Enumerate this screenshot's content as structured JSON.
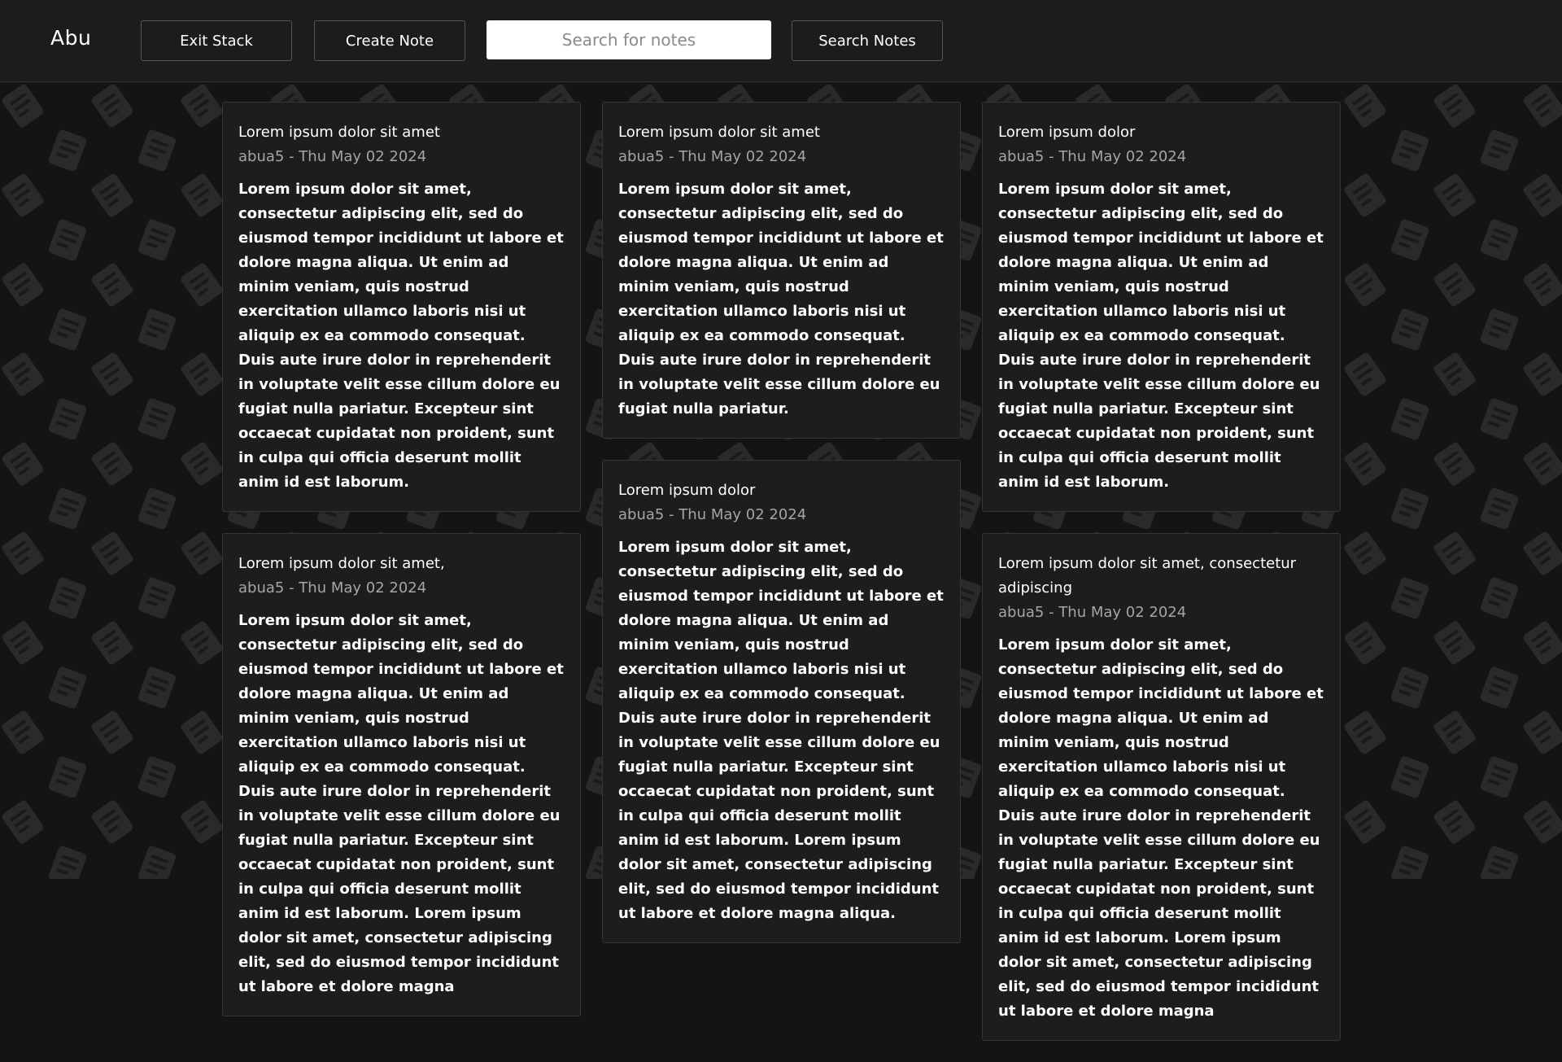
{
  "header": {
    "brand": "Abu",
    "exit_label": "Exit Stack",
    "create_label": "Create Note",
    "search_placeholder": "Search for notes",
    "search_value": "",
    "search_button_label": "Search Notes"
  },
  "columns": [
    {
      "notes": [
        {
          "title": "Lorem ipsum dolor sit amet",
          "meta": "abua5 - Thu May 02 2024",
          "body": "Lorem ipsum dolor sit amet, consectetur adipiscing elit, sed do eiusmod tempor incididunt ut labore et dolore magna aliqua. Ut enim ad minim veniam, quis nostrud exercitation ullamco laboris nisi ut aliquip ex ea commodo consequat. Duis aute irure dolor in reprehenderit in voluptate velit esse cillum dolore eu fugiat nulla pariatur. Excepteur sint occaecat cupidatat non proident, sunt in culpa qui officia deserunt mollit anim id est laborum."
        },
        {
          "title": "Lorem ipsum dolor sit amet,",
          "meta": "abua5 - Thu May 02 2024",
          "body": "Lorem ipsum dolor sit amet, consectetur adipiscing elit, sed do eiusmod tempor incididunt ut labore et dolore magna aliqua. Ut enim ad minim veniam, quis nostrud exercitation ullamco laboris nisi ut aliquip ex ea commodo consequat. Duis aute irure dolor in reprehenderit in voluptate velit esse cillum dolore eu fugiat nulla pariatur. Excepteur sint occaecat cupidatat non proident, sunt in culpa qui officia deserunt mollit anim id est laborum. Lorem ipsum dolor sit amet, consectetur adipiscing elit, sed do eiusmod tempor incididunt ut labore et dolore magna"
        }
      ]
    },
    {
      "notes": [
        {
          "title": "Lorem ipsum dolor sit amet",
          "meta": "abua5 - Thu May 02 2024",
          "body": "Lorem ipsum dolor sit amet, consectetur adipiscing elit, sed do eiusmod tempor incididunt ut labore et dolore magna aliqua. Ut enim ad minim veniam, quis nostrud exercitation ullamco laboris nisi ut aliquip ex ea commodo consequat. Duis aute irure dolor in reprehenderit in voluptate velit esse cillum dolore eu fugiat nulla pariatur."
        },
        {
          "title": "Lorem ipsum dolor",
          "meta": "abua5 - Thu May 02 2024",
          "body": "Lorem ipsum dolor sit amet, consectetur adipiscing elit, sed do eiusmod tempor incididunt ut labore et dolore magna aliqua. Ut enim ad minim veniam, quis nostrud exercitation ullamco laboris nisi ut aliquip ex ea commodo consequat. Duis aute irure dolor in reprehenderit in voluptate velit esse cillum dolore eu fugiat nulla pariatur. Excepteur sint occaecat cupidatat non proident, sunt in culpa qui officia deserunt mollit anim id est laborum. Lorem ipsum dolor sit amet, consectetur adipiscing elit, sed do eiusmod tempor incididunt ut labore et dolore magna aliqua."
        }
      ]
    },
    {
      "notes": [
        {
          "title": "Lorem ipsum dolor",
          "meta": "abua5 - Thu May 02 2024",
          "body": "Lorem ipsum dolor sit amet, consectetur adipiscing elit, sed do eiusmod tempor incididunt ut labore et dolore magna aliqua. Ut enim ad minim veniam, quis nostrud exercitation ullamco laboris nisi ut aliquip ex ea commodo consequat. Duis aute irure dolor in reprehenderit in voluptate velit esse cillum dolore eu fugiat nulla pariatur. Excepteur sint occaecat cupidatat non proident, sunt in culpa qui officia deserunt mollit anim id est laborum."
        },
        {
          "title": "Lorem ipsum dolor sit amet, consectetur adipiscing",
          "meta": "abua5 - Thu May 02 2024",
          "body": "Lorem ipsum dolor sit amet, consectetur adipiscing elit, sed do eiusmod tempor incididunt ut labore et dolore magna aliqua. Ut enim ad minim veniam, quis nostrud exercitation ullamco laboris nisi ut aliquip ex ea commodo consequat. Duis aute irure dolor in reprehenderit in voluptate velit esse cillum dolore eu fugiat nulla pariatur. Excepteur sint occaecat cupidatat non proident, sunt in culpa qui officia deserunt mollit anim id est laborum. Lorem ipsum dolor sit amet, consectetur adipiscing elit, sed do eiusmod tempor incididunt ut labore et dolore magna"
        }
      ]
    }
  ]
}
